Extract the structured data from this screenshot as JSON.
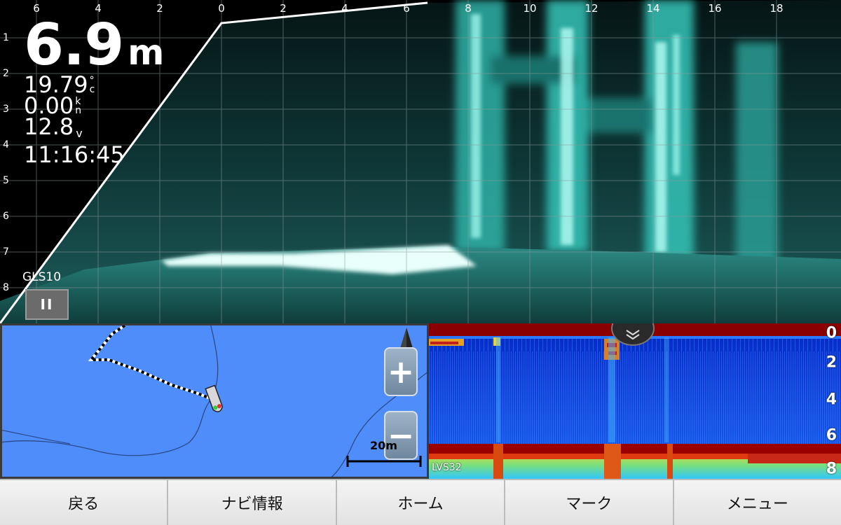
{
  "sonar": {
    "horizontal_scale": [
      "6",
      "4",
      "2",
      "0",
      "2",
      "4",
      "6",
      "8",
      "10",
      "12",
      "14",
      "16",
      "18"
    ],
    "vertical_scale": [
      "1",
      "2",
      "3",
      "4",
      "5",
      "6",
      "7",
      "8"
    ],
    "depth": {
      "value": "6.9",
      "unit": "m"
    },
    "temperature": {
      "value": "19.79",
      "unit_top": "°",
      "unit_bottom": "c"
    },
    "speed": {
      "value": "0.00",
      "unit_top": "k",
      "unit_bottom": "n"
    },
    "voltage": {
      "value": "12.8",
      "unit": "v"
    },
    "time": "11:16:45",
    "transducer_label": "GLS10",
    "pause_label": "II"
  },
  "map": {
    "zoom_in_label": "+",
    "zoom_out_label": "−",
    "scale_label": "20m",
    "colors": {
      "water": "#4f8dfb",
      "shoreline": "#2b4a8a"
    }
  },
  "echo": {
    "depth_scale": [
      "0",
      "2",
      "4",
      "6",
      "8"
    ],
    "transducer_label": "LVS32"
  },
  "toolbar": {
    "back": "戻る",
    "navi_info": "ナビ情報",
    "home": "ホーム",
    "mark": "マーク",
    "menu": "メニュー"
  },
  "colors": {
    "sonar_return": "#39d6c6",
    "echo_bottom": "#9a0000",
    "echo_background": "#0a2fd0"
  }
}
